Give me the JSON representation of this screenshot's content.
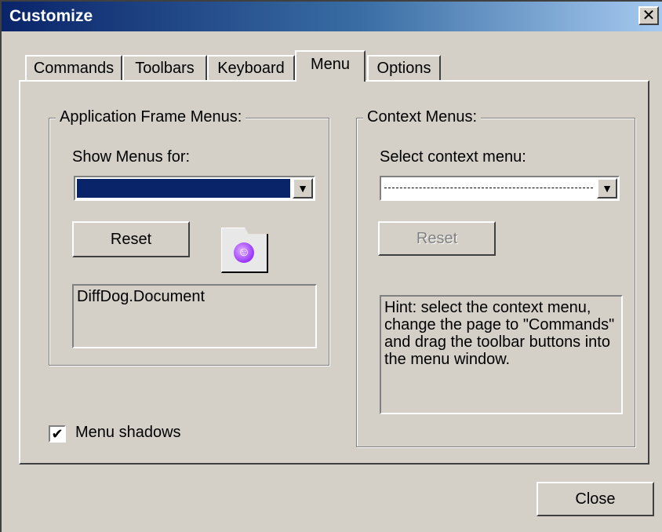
{
  "window": {
    "title": "Customize",
    "close_glyph": "✕"
  },
  "tabs": [
    {
      "label": "Commands",
      "active": false
    },
    {
      "label": "Toolbars",
      "active": false
    },
    {
      "label": "Keyboard",
      "active": false
    },
    {
      "label": "Menu",
      "active": true
    },
    {
      "label": "Options",
      "active": false
    }
  ],
  "app_frame_group": {
    "title": "Application Frame Menus:",
    "show_label": "Show Menus for:",
    "combo_value": "",
    "combo_arrow": "▼",
    "reset_label": "Reset",
    "icon": "document-app-icon",
    "icon_glyph": "☺",
    "doc_name": "DiffDog.Document"
  },
  "context_group": {
    "title": "Context Menus:",
    "select_label": "Select context menu:",
    "combo_value": "",
    "combo_arrow": "▼",
    "reset_label": "Reset",
    "hint": "Hint: select the context menu, change the page to \"Commands\" and drag the toolbar buttons into the menu window."
  },
  "menu_shadows": {
    "label": "Menu shadows",
    "checked": true,
    "check_glyph": "✔"
  },
  "close_button": "Close",
  "colors": {
    "dialog_bg": "#d4d0c8",
    "title_start": "#0a246a",
    "title_end": "#a6caf0",
    "combo_selected": "#0a246a",
    "icon_accent": "#9933ff"
  }
}
